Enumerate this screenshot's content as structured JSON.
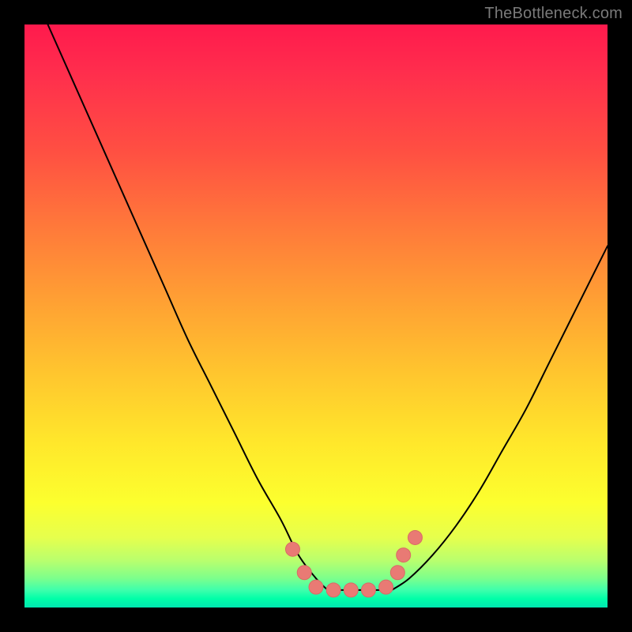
{
  "watermark": "TheBottleneck.com",
  "colors": {
    "frame": "#000000",
    "curve_stroke": "#000000",
    "marker_fill": "#e97a74",
    "marker_stroke": "#d86b65",
    "gradient_stops": [
      "#ff1a4d",
      "#ff2d4d",
      "#ff5042",
      "#ff7a3a",
      "#ffa233",
      "#ffc62e",
      "#ffe82b",
      "#fcff2e",
      "#e6ff4d",
      "#b8ff6e",
      "#7cff8c",
      "#3effac",
      "#00ffa8",
      "#00e6b0"
    ]
  },
  "chart_data": {
    "type": "line",
    "title": "",
    "xlabel": "",
    "ylabel": "",
    "xlim": [
      0,
      100
    ],
    "ylim": [
      0,
      100
    ],
    "grid": false,
    "legend": false,
    "series": [
      {
        "name": "left-curve",
        "x": [
          4,
          8,
          12,
          16,
          20,
          24,
          28,
          32,
          36,
          40,
          44,
          47,
          50,
          52
        ],
        "y": [
          100,
          91,
          82,
          73,
          64,
          55,
          46,
          38,
          30,
          22,
          15,
          9,
          5,
          3
        ]
      },
      {
        "name": "right-curve",
        "x": [
          63,
          66,
          70,
          74,
          78,
          82,
          86,
          90,
          94,
          98,
          100
        ],
        "y": [
          3,
          5,
          9,
          14,
          20,
          27,
          34,
          42,
          50,
          58,
          62
        ]
      },
      {
        "name": "flat-bottom",
        "x": [
          52,
          55,
          58,
          61,
          63
        ],
        "y": [
          3,
          3,
          3,
          3,
          3
        ]
      }
    ],
    "markers": {
      "name": "highlight-dots",
      "x": [
        46,
        48,
        50,
        53,
        56,
        59,
        62,
        64,
        65,
        67
      ],
      "y": [
        10,
        6,
        3.5,
        3,
        3,
        3,
        3.5,
        6,
        9,
        12
      ]
    }
  }
}
